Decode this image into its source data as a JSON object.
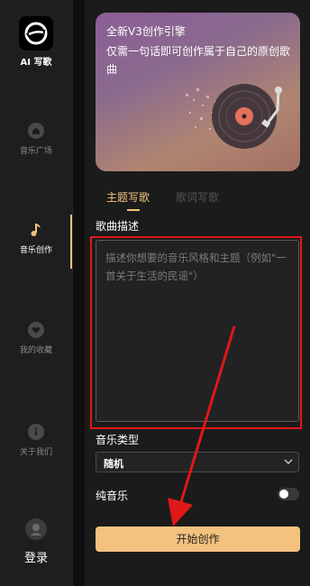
{
  "sidebar": {
    "logo_text": "AI 写歌",
    "items": [
      {
        "label": "音乐广场",
        "icon": "home-icon"
      },
      {
        "label": "音乐创作",
        "icon": "music-note-icon",
        "active": true
      },
      {
        "label": "我的收藏",
        "icon": "heart-icon"
      },
      {
        "label": "关于我们",
        "icon": "info-icon"
      }
    ],
    "login_label": "登录",
    "accent_color": "#f2c37a"
  },
  "banner": {
    "line1": "全新V3创作引擎",
    "line2": "仅需一句话即可创作属于自己的原创歌曲"
  },
  "tabs": [
    {
      "label": "主题写歌",
      "active": true
    },
    {
      "label": "歌词写歌",
      "active": false
    }
  ],
  "form": {
    "description_label": "歌曲描述",
    "description_placeholder": "描述你想要的音乐风格和主题（例如\"一首关于生活的民谣\"）",
    "music_type_label": "音乐类型",
    "music_type_value": "随机",
    "instrumental_label": "纯音乐",
    "instrumental_on": false,
    "start_button": "开始创作",
    "button_color": "#f4c27f"
  },
  "annotation_color": "#e01818"
}
